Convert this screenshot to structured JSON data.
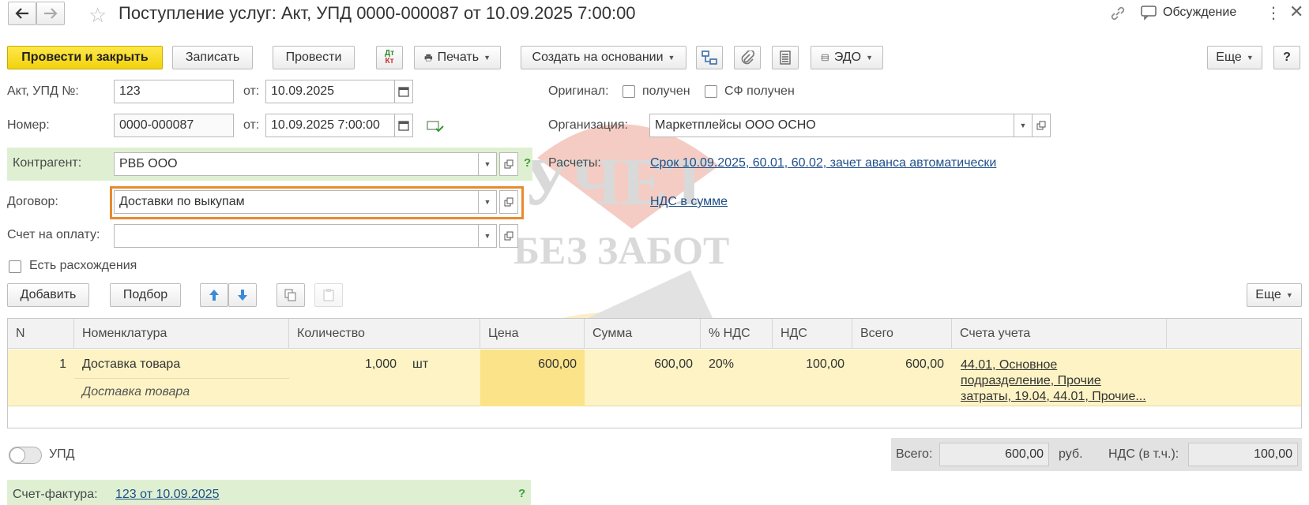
{
  "window": {
    "title": "Поступление услуг: Акт, УПД 0000-000087 от 10.09.2025 7:00:00",
    "discussion_label": "Обсуждение"
  },
  "toolbar": {
    "post_close_label": "Провести и закрыть",
    "save_label": "Записать",
    "post_label": "Провести",
    "dt_kt_top": "Дт",
    "dt_kt_bottom": "Кт",
    "print_label": "Печать",
    "create_based_label": "Создать на основании",
    "edo_label": "ЭДО",
    "more_label": "Еще",
    "help_label": "?"
  },
  "form": {
    "act_label": "Акт, УПД №:",
    "act_value": "123",
    "from_label": "от:",
    "act_date": "10.09.2025",
    "number_label": "Номер:",
    "number_value": "0000-000087",
    "number_date": "10.09.2025  7:00:00",
    "original_label": "Оригинал:",
    "received_label": "получен",
    "sf_received_label": "СФ получен",
    "org_label": "Организация:",
    "org_value": "Маркетплейсы ООО ОСНО",
    "counterparty_label": "Контрагент:",
    "counterparty_value": "РВБ ООО",
    "counterparty_help": "?",
    "settlements_label": "Расчеты:",
    "settlements_link": "Срок 10.09.2025, 60.01, 60.02, зачет аванса автоматически",
    "contract_label": "Договор:",
    "contract_value": "Доставки по выкупам",
    "vat_link": "НДС в сумме",
    "invoice_label": "Счет на оплату:",
    "invoice_value": "",
    "discrepancy_label": "Есть расхождения"
  },
  "table_toolbar": {
    "add_label": "Добавить",
    "pick_label": "Подбор",
    "more_label": "Еще"
  },
  "table": {
    "headers": [
      "N",
      "Номенклатура",
      "Количество",
      "Цена",
      "Сумма",
      "% НДС",
      "НДС",
      "Всего",
      "Счета учета"
    ],
    "rows": [
      {
        "n": "1",
        "item": "Доставка товара",
        "item_content": "Доставка товара",
        "qty": "1,000",
        "unit": "шт",
        "price": "600,00",
        "sum": "600,00",
        "vat_rate": "20%",
        "vat": "100,00",
        "total": "600,00",
        "accounts": [
          "44.01, Основное",
          "подразделение, Прочие",
          "затраты, 19.04, 44.01, Прочие..."
        ]
      }
    ]
  },
  "footer": {
    "upd_label": "УПД",
    "total_label": "Всего:",
    "total_value": "600,00",
    "currency": "руб.",
    "vat_label": "НДС (в т.ч.):",
    "vat_value": "100,00",
    "invoice_label": "Счет-фактура:",
    "invoice_link": "123 от 10.09.2025",
    "help": "?"
  },
  "watermark": {
    "line1": "УЧЕТ",
    "line2": "БЕЗ ЗАБОТ"
  },
  "colors": {
    "primary_button": "#f2d20c",
    "highlight_green": "#dff0d2",
    "row_yellow": "#fdf3c4",
    "focus_orange": "#e88a2e",
    "link": "#1f4f88"
  }
}
